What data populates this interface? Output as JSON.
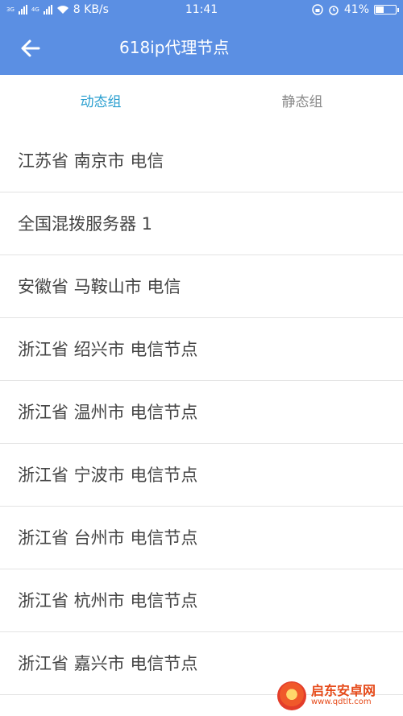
{
  "status_bar": {
    "network_3g": "3G",
    "network_4g": "4G",
    "speed": "8 KB/s",
    "time": "11:41",
    "battery": "41%",
    "battery_level": 0.41
  },
  "header": {
    "title": "618ip代理节点",
    "back_icon": "arrow-left-icon"
  },
  "tabs": [
    {
      "label": "动态组",
      "active": true
    },
    {
      "label": "静态组",
      "active": false
    }
  ],
  "nodes": [
    "江苏省 南京市 电信",
    "全国混拨服务器 1",
    "安徽省 马鞍山市 电信",
    "浙江省 绍兴市 电信节点",
    "浙江省 温州市 电信节点",
    "浙江省 宁波市 电信节点",
    "浙江省 台州市 电信节点",
    "浙江省 杭州市 电信节点",
    "浙江省 嘉兴市 电信节点"
  ],
  "watermark": {
    "name": "启东安卓网",
    "url": "www.qdtlt.com"
  },
  "colors": {
    "header_bg": "#5b8fe3",
    "active_tab": "#2a9fd0",
    "inactive_tab": "#8a8a8a",
    "item_text": "#444444",
    "divider": "#e3e3e3"
  }
}
